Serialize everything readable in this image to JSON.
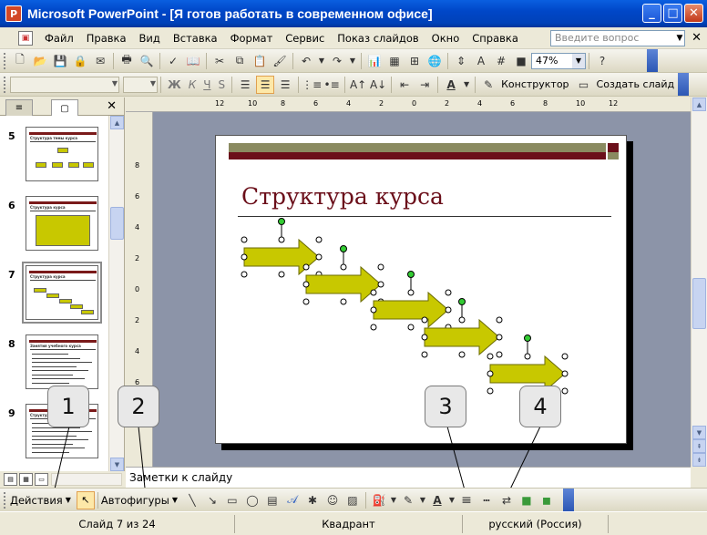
{
  "window": {
    "title": "Microsoft PowerPoint - [Я готов работать в современном офисе]",
    "app_icon": "powerpoint-icon",
    "app_icon_letter": "P"
  },
  "menu": {
    "items": [
      "Файл",
      "Правка",
      "Вид",
      "Вставка",
      "Формат",
      "Сервис",
      "Показ слайдов",
      "Окно",
      "Справка"
    ],
    "help_placeholder": "Введите вопрос"
  },
  "standard_toolbar": {
    "zoom": "47%"
  },
  "formatting_toolbar": {
    "bold": "Ж",
    "italic": "К",
    "underline": "Ч",
    "shadow": "S",
    "designer_label": "Конструктор",
    "new_slide_label": "Создать слайд"
  },
  "ruler": {
    "h_ticks": [
      "12",
      "10",
      "8",
      "6",
      "4",
      "2",
      "0",
      "2",
      "4",
      "6",
      "8",
      "10",
      "12"
    ],
    "v_ticks": [
      "8",
      "6",
      "4",
      "2",
      "0",
      "2",
      "4",
      "6",
      "8"
    ]
  },
  "slides_panel": {
    "thumbnails": [
      {
        "number": "5",
        "title": "Структура темы курса"
      },
      {
        "number": "6",
        "title": "Структура курса"
      },
      {
        "number": "7",
        "title": "Структура курса"
      },
      {
        "number": "8",
        "title": "Занятия учебного курса"
      },
      {
        "number": "9",
        "title": "Структура курса"
      },
      {
        "number": "10",
        "title": ""
      }
    ]
  },
  "slide": {
    "title": "Структура курса",
    "colors": {
      "band_olive": "#8a8a60",
      "band_maroon": "#6b0f1a",
      "arrow_fill": "#c8c800",
      "arrow_stroke": "#6b6b00"
    }
  },
  "notes": {
    "placeholder": "Заметки к слайду"
  },
  "drawing_toolbar": {
    "actions_label": "Действия",
    "autoshapes_label": "Автофигуры"
  },
  "callouts": [
    "1",
    "2",
    "3",
    "4"
  ],
  "status": {
    "slide_info": "Слайд 7 из 24",
    "design": "Квадрант",
    "language": "русский (Россия)"
  }
}
